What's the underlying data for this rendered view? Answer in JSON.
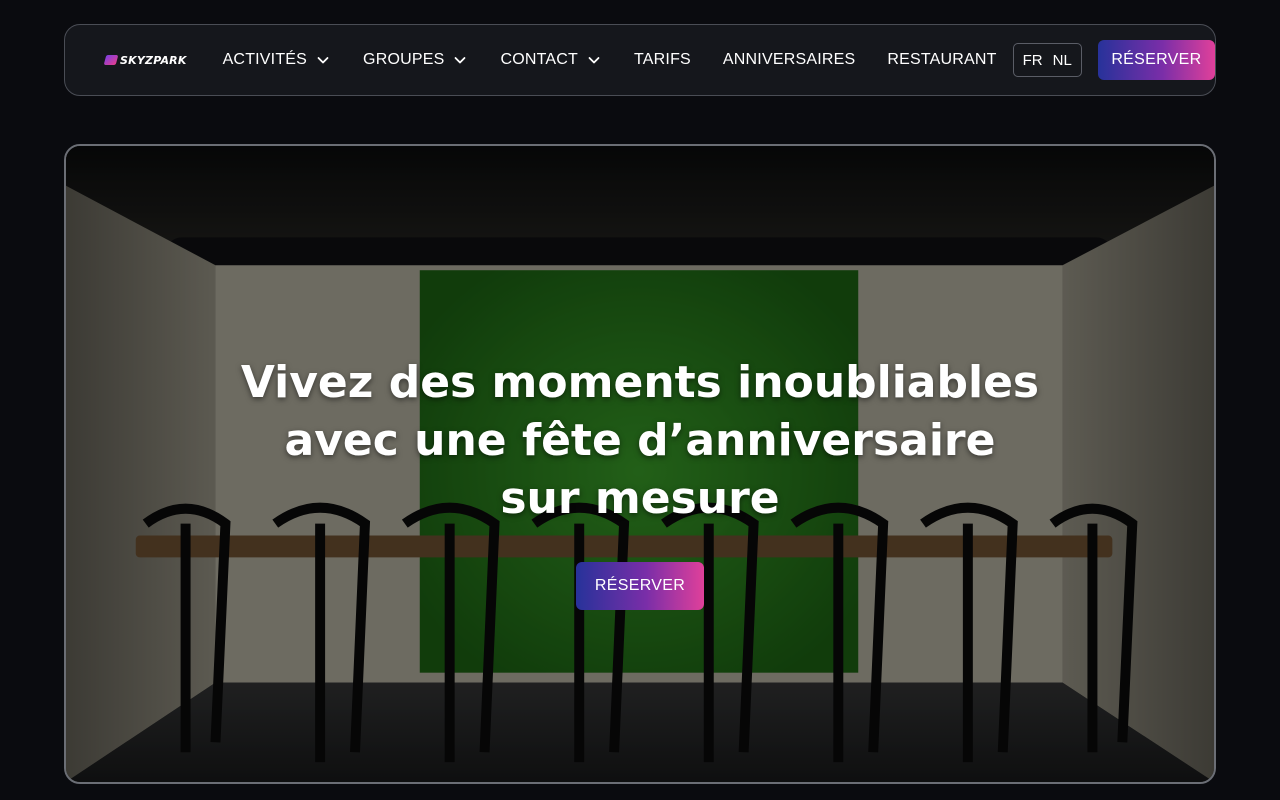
{
  "brand": {
    "logo_text": "SKYZPARK",
    "gradient_start": "#27329a",
    "gradient_end": "#e0409a"
  },
  "nav": {
    "items": [
      {
        "label": "ACTIVITÉS",
        "has_dropdown": true
      },
      {
        "label": "GROUPES",
        "has_dropdown": true
      },
      {
        "label": "CONTACT",
        "has_dropdown": true
      },
      {
        "label": "TARIFS",
        "has_dropdown": false
      },
      {
        "label": "ANNIVERSAIRES",
        "has_dropdown": false
      },
      {
        "label": "RESTAURANT",
        "has_dropdown": false
      }
    ],
    "languages": [
      "FR",
      "NL"
    ],
    "reserve_label": "RÉSERVER",
    "dropdown_icon": "chevron-down-icon"
  },
  "hero": {
    "title": "Vivez des moments inoubliables avec une fête d’anniversaire sur mesure",
    "reserve_label": "RÉSERVER",
    "background": "party-room-photo"
  }
}
